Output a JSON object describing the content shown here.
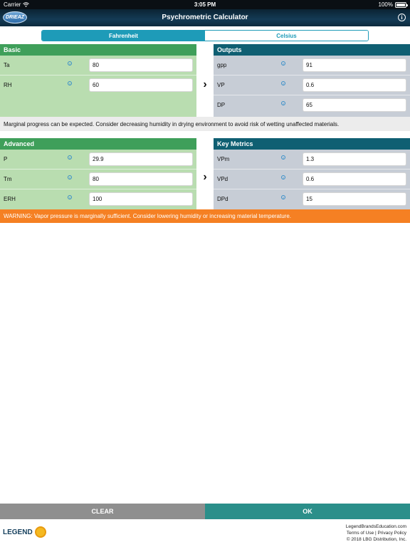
{
  "status_bar": {
    "carrier": "Carrier",
    "time": "3:05 PM",
    "battery": "100%",
    "battery_level": 1.0
  },
  "nav": {
    "logo_text": "DRIEAZ",
    "title": "Psychrometric Calculator",
    "info_icon": "info-icon"
  },
  "units": {
    "options": [
      "Fahrenheit",
      "Celsius"
    ],
    "selected": "Fahrenheit"
  },
  "basic": {
    "title": "Basic",
    "rows": [
      {
        "label": "Ta",
        "value": "80"
      },
      {
        "label": "RH",
        "value": "60"
      }
    ]
  },
  "outputs": {
    "title": "Outputs",
    "rows": [
      {
        "label": "gpp",
        "value": "91"
      },
      {
        "label": "VP",
        "value": "0.6"
      },
      {
        "label": "DP",
        "value": "65"
      }
    ]
  },
  "note": "Marginal progress can be expected. Consider decreasing humidity in drying environment to avoid risk of wetting  unaffected materials.",
  "advanced": {
    "title": "Advanced",
    "rows": [
      {
        "label": "P",
        "value": "29.9"
      },
      {
        "label": "Tm",
        "value": "80"
      },
      {
        "label": "ERH",
        "value": "100"
      }
    ]
  },
  "key_metrics": {
    "title": "Key Metrics",
    "rows": [
      {
        "label": "VPm",
        "value": "1.3"
      },
      {
        "label": "VPd",
        "value": "0.6"
      },
      {
        "label": "DPd",
        "value": "15"
      }
    ]
  },
  "warning": "WARNING: Vapor pressure is marginally sufficient. Consider lowering humidity or increasing material temperature.",
  "actions": {
    "clear": "CLEAR",
    "ok": "OK"
  },
  "footer": {
    "brand": "LEGEND",
    "website": "LegendBrandsEducation.com",
    "terms": "Terms of Use",
    "separator": " | ",
    "privacy": "Privacy Policy",
    "copyright": "© 2018 LBG Distribution, Inc."
  },
  "colors": {
    "green_header": "#3f9f5a",
    "green_body": "#b9ddb0",
    "teal_header": "#0f5f72",
    "gray_body": "#c7cdd6",
    "accent": "#1e9bb8",
    "warning": "#f58023",
    "ok": "#2b8f8a",
    "clear": "#8f8f8f"
  }
}
